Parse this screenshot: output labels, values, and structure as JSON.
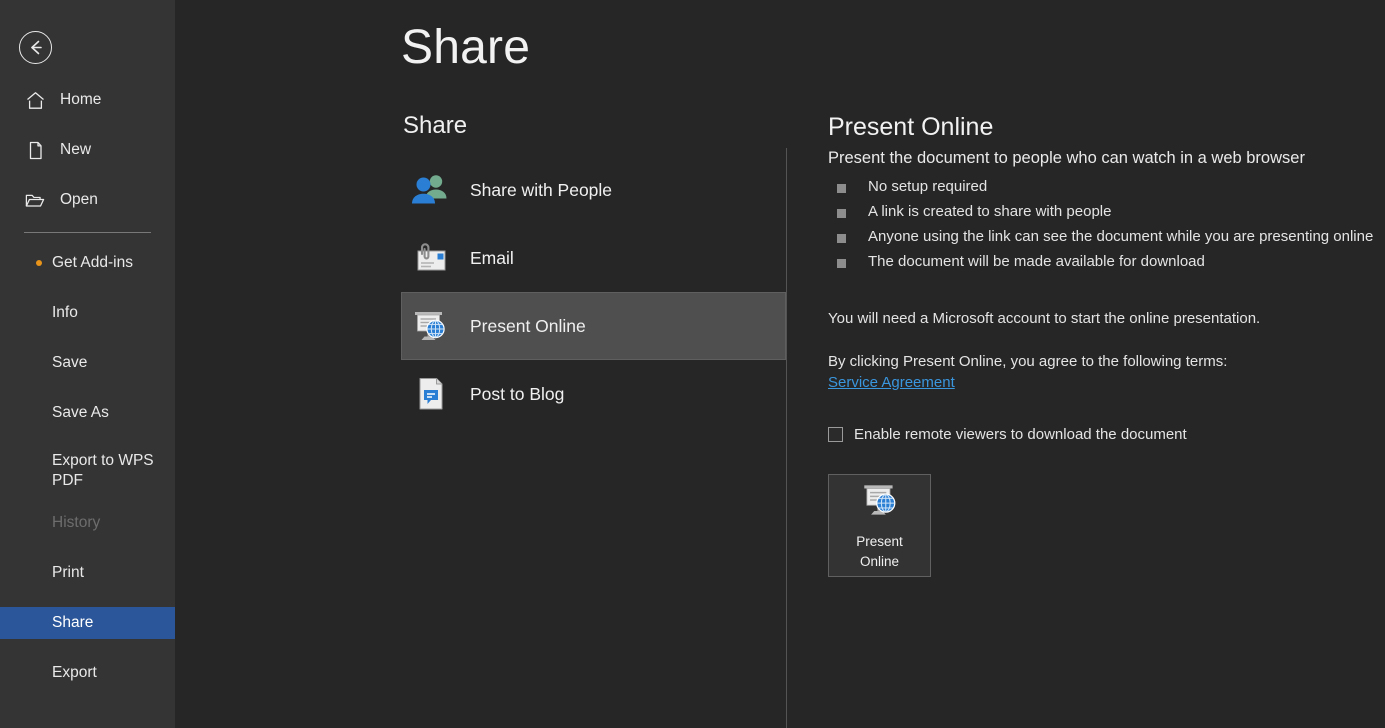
{
  "window": {
    "title": "Share",
    "back_button": "back-arrow"
  },
  "sidebar": {
    "top_items": [
      {
        "label": "Home",
        "icon": "home-icon"
      },
      {
        "label": "New",
        "icon": "new-document-icon"
      },
      {
        "label": "Open",
        "icon": "open-folder-icon"
      }
    ],
    "sub_items": [
      {
        "label": "Get Add-ins",
        "state": "normal",
        "badge": "orange-dot"
      },
      {
        "label": "Info",
        "state": "normal"
      },
      {
        "label": "Save",
        "state": "normal"
      },
      {
        "label": "Save As",
        "state": "normal"
      },
      {
        "label": "Export to WPS PDF",
        "state": "normal"
      },
      {
        "label": "History",
        "state": "disabled"
      },
      {
        "label": "Print",
        "state": "normal"
      },
      {
        "label": "Share",
        "state": "selected"
      },
      {
        "label": "Export",
        "state": "normal"
      }
    ],
    "selected": "Share",
    "highlight_color": "#2b579a",
    "background_color": "#343434"
  },
  "main": {
    "page_title": "Share",
    "share_column": {
      "heading": "Share",
      "items": [
        {
          "label": "Share with People",
          "icon": "people-icon",
          "selected": false
        },
        {
          "label": "Email",
          "icon": "email-attachment-icon",
          "selected": false
        },
        {
          "label": "Present Online",
          "icon": "present-online-icon",
          "selected": true
        },
        {
          "label": "Post to Blog",
          "icon": "blog-post-icon",
          "selected": false
        }
      ]
    },
    "detail": {
      "title": "Present Online",
      "subtitle": "Present the document to people who can watch in a web browser",
      "bullets": [
        "No setup required",
        "A link is created to share with people",
        "Anyone using the link can see the document while you are presenting online",
        "The document will be made available for download"
      ],
      "account_note": "You will need a Microsoft account to start the online presentation.",
      "terms_note": "By clicking Present Online, you agree to the following terms:",
      "service_agreement_link": "Service Agreement",
      "checkbox": {
        "label": "Enable remote viewers to download the document",
        "checked": false
      },
      "action_button": {
        "label": "Present\nOnline",
        "icon": "present-online-icon"
      }
    }
  },
  "colors": {
    "accent": "#2b579a",
    "link": "#3a96dd",
    "background": "#262626",
    "sidebar": "#343434",
    "badge_dot": "#e8941a"
  }
}
